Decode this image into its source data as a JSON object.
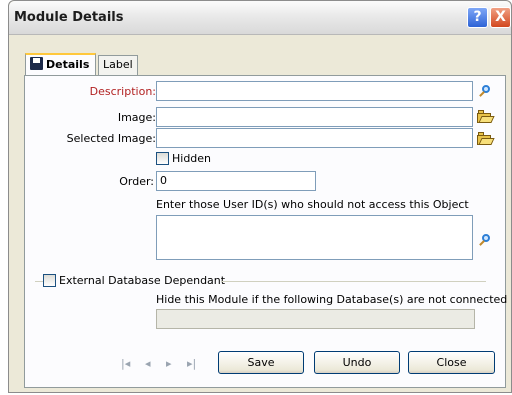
{
  "window": {
    "title": "Module Details",
    "help_glyph": "?",
    "close_glyph": "X"
  },
  "tabs": [
    {
      "label": "Details",
      "active": true
    },
    {
      "label": "Label",
      "active": false
    }
  ],
  "form": {
    "description_label": "Description:",
    "description_value": "",
    "image_label": "Image:",
    "image_value": "",
    "selected_image_label": "Selected Image:",
    "selected_image_value": "",
    "hidden_label": "Hidden",
    "hidden_checked": false,
    "order_label": "Order:",
    "order_value": "0",
    "user_ids_hint": "Enter those User ID(s) who should not access this Object",
    "user_ids_value": "",
    "external_db_label": "External Database Dependant",
    "external_db_checked": false,
    "external_db_hint": "Hide this Module if the following Database(s) are not connected",
    "external_db_value": ""
  },
  "navigation": {
    "first_glyph": "|◂",
    "prev_glyph": "◂",
    "next_glyph": "▸",
    "last_glyph": "▸|"
  },
  "buttons": {
    "save": "Save",
    "undo": "Undo",
    "close": "Close"
  },
  "colors": {
    "required_label": "#b22222",
    "dialog_bg": "#ece9d8",
    "field_border": "#7f9db9"
  }
}
